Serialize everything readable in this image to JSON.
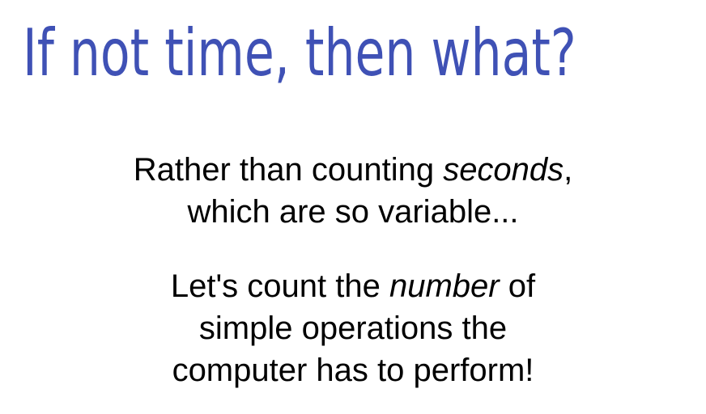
{
  "slide": {
    "title": "If not time, then what?",
    "paragraph1": {
      "line1_pre": "Rather than counting ",
      "line1_em": "seconds",
      "line1_post": ",",
      "line2": "which are so variable..."
    },
    "paragraph2": {
      "line1_pre": "Let's count the ",
      "line1_em": "number",
      "line1_post": " of",
      "line2": "simple operations the",
      "line3": "computer has to perform!"
    }
  },
  "colors": {
    "title": "#3f51b5",
    "body_text": "#000000",
    "background": "#ffffff"
  }
}
